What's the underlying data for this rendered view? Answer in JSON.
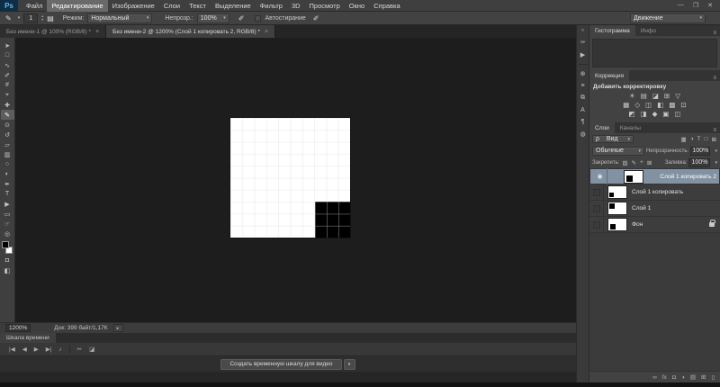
{
  "window": {
    "logo": "Ps",
    "controls": {
      "minimize": "—",
      "restore": "❐",
      "close": "✕"
    }
  },
  "menubar": {
    "items": [
      "Файл",
      "Редактирование",
      "Изображение",
      "Слои",
      "Текст",
      "Выделение",
      "Фильтр",
      "3D",
      "Просмотр",
      "Окно",
      "Справка"
    ]
  },
  "options": {
    "tool_icon": "✎",
    "tool_dropdown": "▾",
    "size_value": "1",
    "stepper_up": "▴",
    "stepper_down": "▾",
    "brush_panel_icon": "▤",
    "mode_label": "Режим:",
    "mode_value": "Нормальный",
    "select_arrow": "▾",
    "opacity_label": "Непрозр.:",
    "opacity_value": "100%",
    "airbrush_icon": "✐",
    "auto_erase_label": "Автостирание",
    "smoothing_icon": "✐"
  },
  "workspace": {
    "value": "Движение",
    "arrow": "▾"
  },
  "tabs": {
    "docs": [
      {
        "title": "Без имени-1 @ 100% (RGB/8) *",
        "close": "×"
      },
      {
        "title": "Без имени-2 @ 1200% (Слой 1 копировать 2, RGB/8) *",
        "close": "×"
      }
    ]
  },
  "toolbox": {
    "tools": [
      {
        "name": "move-tool",
        "glyph": "➤"
      },
      {
        "name": "marquee-tool",
        "glyph": "□"
      },
      {
        "name": "lasso-tool",
        "glyph": "∿"
      },
      {
        "name": "quick-selection-tool",
        "glyph": "✐"
      },
      {
        "name": "crop-tool",
        "glyph": "#"
      },
      {
        "name": "eyedropper-tool",
        "glyph": "⌖"
      },
      {
        "name": "healing-brush-tool",
        "glyph": "✚"
      },
      {
        "name": "pencil-tool",
        "glyph": "✎"
      },
      {
        "name": "clone-stamp-tool",
        "glyph": "⊙"
      },
      {
        "name": "history-brush-tool",
        "glyph": "↺"
      },
      {
        "name": "eraser-tool",
        "glyph": "▱"
      },
      {
        "name": "gradient-tool",
        "glyph": "▥"
      },
      {
        "name": "blur-tool",
        "glyph": "○"
      },
      {
        "name": "dodge-tool",
        "glyph": "◐"
      },
      {
        "name": "pen-tool",
        "glyph": "✒"
      },
      {
        "name": "type-tool",
        "glyph": "T"
      },
      {
        "name": "path-selection-tool",
        "glyph": "▶"
      },
      {
        "name": "shape-tool",
        "glyph": "▭"
      },
      {
        "name": "hand-tool",
        "glyph": "☞"
      },
      {
        "name": "zoom-tool",
        "glyph": "◎"
      }
    ],
    "quick_mask_icon": "◘",
    "screen_mode_icon": "◧"
  },
  "dock": {
    "expand": "«",
    "icons": [
      {
        "name": "brush-presets-panel",
        "glyph": "✑"
      },
      {
        "name": "actions-panel",
        "glyph": "▶"
      },
      {
        "name": "clone-source-panel",
        "glyph": "⊕"
      },
      {
        "name": "adjust-sliders-panel",
        "glyph": "≡"
      },
      {
        "name": "layer-comps-panel",
        "glyph": "⧉"
      },
      {
        "name": "character-panel",
        "glyph": "A"
      },
      {
        "name": "paragraph-panel",
        "glyph": "¶"
      },
      {
        "name": "3d-panel",
        "glyph": "◍"
      }
    ]
  },
  "panels": {
    "menu_icon": "≡",
    "histogram": {
      "tab": "Гистограмма",
      "tab2": "Инфо"
    },
    "adjustments": {
      "tab": "Коррекция",
      "title": "Добавить корректировку",
      "rows": [
        [
          "☀",
          "▤",
          "◪",
          "⊞",
          "▽"
        ],
        [
          "▦",
          "◇",
          "◫",
          "◧",
          "▩",
          "⊡"
        ],
        [
          "◩",
          "◨",
          "◆",
          "▣",
          "◫"
        ]
      ]
    },
    "layers": {
      "tab": "Слои",
      "tab2": "Каналы",
      "search_icon": "ρ",
      "filter_value": "Вид",
      "filter_arrow": "▾",
      "filter_icons": [
        "▦",
        "◑",
        "T",
        "□",
        "⊠"
      ],
      "blend_value": "Обычные",
      "opacity_label": "Непрозрачность:",
      "opacity_value": "100%",
      "lock_label": "Закрепить:",
      "lock_icons": [
        "▨",
        "✎",
        "+",
        "⊠"
      ],
      "fill_label": "Заливка:",
      "fill_value": "100%",
      "visible_eye": "◉",
      "items": [
        {
          "name": "Слой 1 копировать 2"
        },
        {
          "name": "Слой 1 копировать"
        },
        {
          "name": "Слой 1"
        },
        {
          "name": "Фон"
        }
      ],
      "footer": [
        {
          "name": "link-layers",
          "glyph": "∞"
        },
        {
          "name": "layer-style",
          "glyph": "fx"
        },
        {
          "name": "layer-mask",
          "glyph": "◘"
        },
        {
          "name": "adjustment-layer",
          "glyph": "◑"
        },
        {
          "name": "layer-group",
          "glyph": "▤"
        },
        {
          "name": "new-layer",
          "glyph": "⊞"
        },
        {
          "name": "delete-layer",
          "glyph": "▯"
        }
      ]
    }
  },
  "status": {
    "zoom": "1200%",
    "doc": "Док: 399 байт/1,17К",
    "arrow": "▸"
  },
  "timeline": {
    "tab": "Шкала времени",
    "transport": [
      {
        "name": "first-frame",
        "glyph": "|◀"
      },
      {
        "name": "previous-frame",
        "glyph": "◀"
      },
      {
        "name": "play",
        "glyph": "▶"
      },
      {
        "name": "next-frame",
        "glyph": "▶|"
      },
      {
        "name": "audio-toggle",
        "glyph": "♪"
      }
    ],
    "split_icon": "✂",
    "transition_icon": "◪",
    "create_button": "Создать временную шкалу для видео",
    "create_arrow": "▾"
  },
  "colors": {
    "selected_layer": "#8292a3",
    "canvas_white": "#ffffff",
    "painted_black": "#000000",
    "ui_panel": "#424242"
  }
}
